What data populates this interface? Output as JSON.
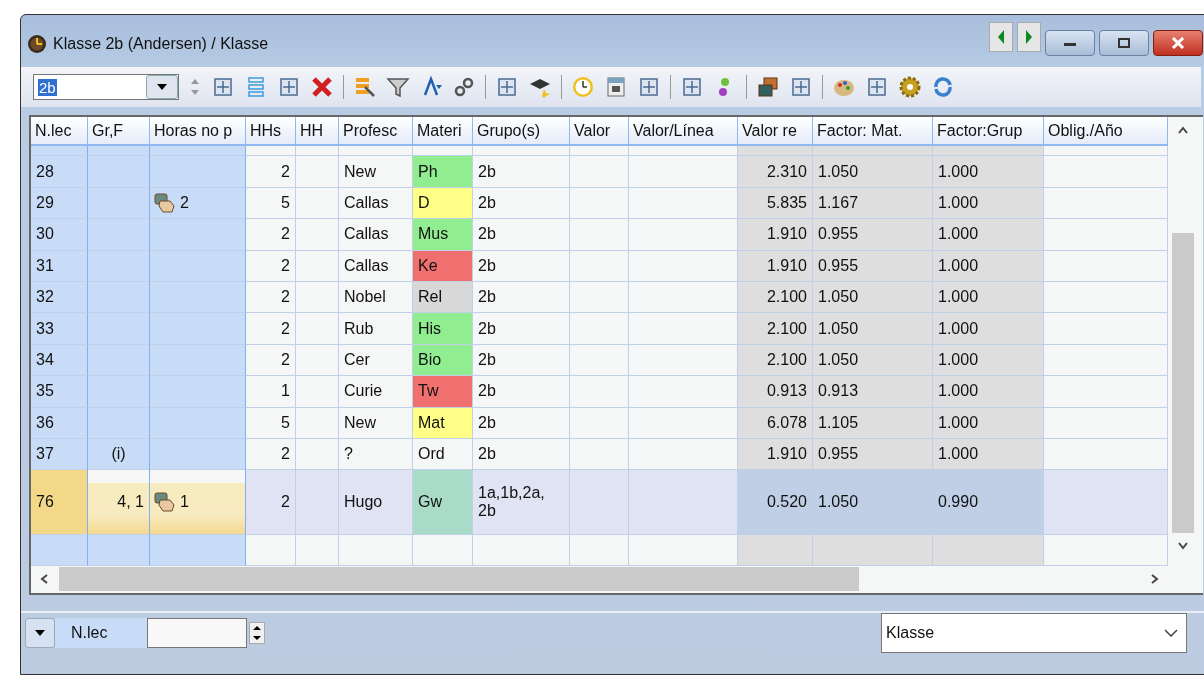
{
  "window": {
    "title": "Klasse 2b (Andersen) / Klasse"
  },
  "toolbar": {
    "class_value": "2b"
  },
  "table": {
    "columns": [
      "N.lec",
      "Gr,F",
      "Horas no p",
      "HHs",
      "HH",
      "Profesc",
      "Materi",
      "Grupo(s)",
      "Valor",
      "Valor/Línea",
      "Valor re",
      "Factor: Mat.",
      "Factor:Grup",
      "Oblig./Año"
    ],
    "rows": [
      {
        "n": "28",
        "gr": "",
        "hours": "",
        "hand": false,
        "hhs": "2",
        "teacher": "New",
        "subject": "Ph",
        "color": "#90ee90",
        "groups": "2b",
        "value": "2.310",
        "f_mat": "1.050",
        "f_group": "1.000",
        "selected": false
      },
      {
        "n": "29",
        "gr": "",
        "hours": "2",
        "hand": true,
        "hhs": "5",
        "teacher": "Callas",
        "subject": "D",
        "color": "#ffff88",
        "groups": "2b",
        "value": "5.835",
        "f_mat": "1.167",
        "f_group": "1.000",
        "selected": false
      },
      {
        "n": "30",
        "gr": "",
        "hours": "",
        "hand": false,
        "hhs": "2",
        "teacher": "Callas",
        "subject": "Mus",
        "color": "#90ee90",
        "groups": "2b",
        "value": "1.910",
        "f_mat": "0.955",
        "f_group": "1.000",
        "selected": false
      },
      {
        "n": "31",
        "gr": "",
        "hours": "",
        "hand": false,
        "hhs": "2",
        "teacher": "Callas",
        "subject": "Ke",
        "color": "#f07070",
        "groups": "2b",
        "value": "1.910",
        "f_mat": "0.955",
        "f_group": "1.000",
        "selected": false
      },
      {
        "n": "32",
        "gr": "",
        "hours": "",
        "hand": false,
        "hhs": "2",
        "teacher": "Nobel",
        "subject": "Rel",
        "color": "#d8d8d8",
        "groups": "2b",
        "value": "2.100",
        "f_mat": "1.050",
        "f_group": "1.000",
        "selected": false
      },
      {
        "n": "33",
        "gr": "",
        "hours": "",
        "hand": false,
        "hhs": "2",
        "teacher": "Rub",
        "subject": "His",
        "color": "#90ee90",
        "groups": "2b",
        "value": "2.100",
        "f_mat": "1.050",
        "f_group": "1.000",
        "selected": false
      },
      {
        "n": "34",
        "gr": "",
        "hours": "",
        "hand": false,
        "hhs": "2",
        "teacher": "Cer",
        "subject": "Bio",
        "color": "#90ee90",
        "groups": "2b",
        "value": "2.100",
        "f_mat": "1.050",
        "f_group": "1.000",
        "selected": false
      },
      {
        "n": "35",
        "gr": "",
        "hours": "",
        "hand": false,
        "hhs": "1",
        "teacher": "Curie",
        "subject": "Tw",
        "color": "#f07070",
        "groups": "2b",
        "value": "0.913",
        "f_mat": "0.913",
        "f_group": "1.000",
        "selected": false
      },
      {
        "n": "36",
        "gr": "",
        "hours": "",
        "hand": false,
        "hhs": "5",
        "teacher": "New",
        "subject": "Mat",
        "color": "#ffff88",
        "groups": "2b",
        "value": "6.078",
        "f_mat": "1.105",
        "f_group": "1.000",
        "selected": false
      },
      {
        "n": "37",
        "gr": "(i)",
        "hours": "",
        "hand": false,
        "hhs": "2",
        "teacher": "?",
        "subject": "Ord",
        "color": "#f5f6f6",
        "groups": "2b",
        "value": "1.910",
        "f_mat": "0.955",
        "f_group": "1.000",
        "selected": false
      },
      {
        "n": "76",
        "gr": "4, 1",
        "hours": "1",
        "hand": true,
        "hhs": "2",
        "teacher": "Hugo",
        "subject": "Gw",
        "color": "#a8dcc8",
        "groups": "1a,1b,2a, 2b",
        "value": "0.520",
        "f_mat": "1.050",
        "f_group": "0.990",
        "selected": true
      }
    ]
  },
  "footer": {
    "field_label": "N.lec",
    "view": "Klasse"
  }
}
